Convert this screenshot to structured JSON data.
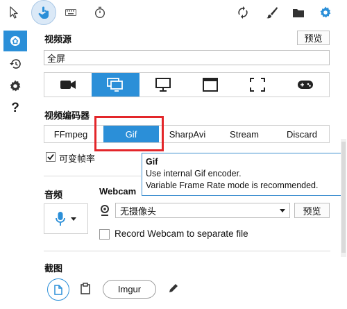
{
  "toolbar": {
    "icons": [
      "cursor-icon",
      "hand-tap-icon",
      "keyboard-icon",
      "timer-icon",
      "refresh-icon",
      "brush-icon",
      "folder-icon",
      "gear-icon"
    ]
  },
  "sidebar": {
    "items": [
      "home-icon",
      "history-icon",
      "settings-icon",
      "help-icon"
    ],
    "help_label": "?"
  },
  "video_source": {
    "label": "视频源",
    "preview_label": "预览",
    "current_value": "全屏",
    "sources": [
      "camera-icon",
      "screen-icon",
      "monitor-icon",
      "window-icon",
      "region-icon",
      "gamepad-icon"
    ],
    "active_index": 1
  },
  "video_encoder": {
    "label": "视频编码器",
    "options": [
      "FFmpeg",
      "Gif",
      "SharpAvi",
      "Stream",
      "Discard"
    ],
    "selected": "Gif",
    "variable_frame_rate_label": "可变帧率",
    "variable_frame_rate_checked": true
  },
  "tooltip": {
    "title": "Gif",
    "line1": "Use internal Gif encoder.",
    "line2": "Variable Frame Rate mode is recommended."
  },
  "audio": {
    "label": "音频"
  },
  "webcam": {
    "label": "Webcam",
    "selected": "无摄像头",
    "preview_label": "预览",
    "separate_file_label": "Record Webcam to separate file",
    "separate_file_checked": false
  },
  "screenshot": {
    "label": "截图",
    "imgur_label": "Imgur"
  },
  "colors": {
    "accent": "#2b8fd8",
    "highlight_border": "#e3262a",
    "tooltip_border": "#3d8fd0"
  }
}
